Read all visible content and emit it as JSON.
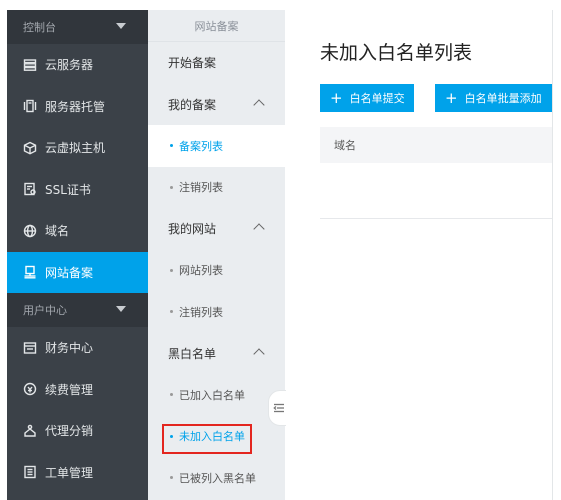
{
  "sidebar": {
    "sections": [
      {
        "label": "控制台"
      },
      {
        "label": "用户中心"
      }
    ],
    "console_items": [
      {
        "label": "云服务器",
        "icon": "server-list-icon"
      },
      {
        "label": "服务器托管",
        "icon": "server-hosting-icon"
      },
      {
        "label": "云虚拟主机",
        "icon": "cube-icon"
      },
      {
        "label": "SSL证书",
        "icon": "certificate-icon"
      },
      {
        "label": "域名",
        "icon": "globe-icon"
      },
      {
        "label": "网站备案",
        "icon": "filing-icon",
        "active": true
      }
    ],
    "user_items": [
      {
        "label": "财务中心",
        "icon": "finance-icon"
      },
      {
        "label": "续费管理",
        "icon": "renewal-icon"
      },
      {
        "label": "代理分销",
        "icon": "agent-icon"
      },
      {
        "label": "工单管理",
        "icon": "ticket-icon"
      }
    ]
  },
  "submenu": {
    "title": "网站备案",
    "start": "开始备案",
    "my_filing": "我的备案",
    "filing_list": "备案列表",
    "cancel_list_1": "注销列表",
    "my_site": "我的网站",
    "site_list": "网站列表",
    "cancel_list_2": "注销列表",
    "black_white": "黑白名单",
    "added_white": "已加入白名单",
    "not_added_white": "未加入白名单",
    "black_listed": "已被列入黑名单"
  },
  "main": {
    "title": "未加入白名单列表",
    "submit_button": "白名单提交",
    "batch_button": "白名单批量添加",
    "table_header": "域名"
  },
  "colors": {
    "accent": "#00a2ea",
    "sidebar_bg": "#3b4148",
    "highlight_border": "#e3261f"
  }
}
